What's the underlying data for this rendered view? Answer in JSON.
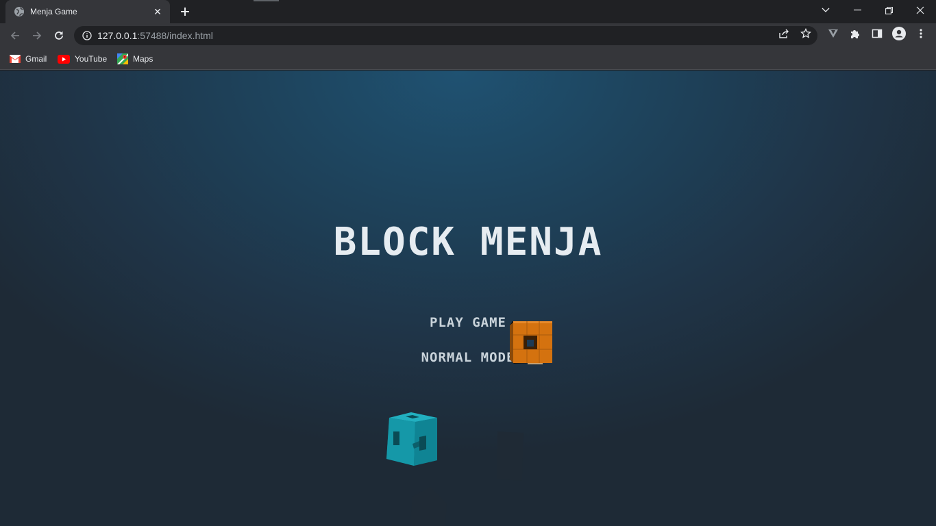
{
  "browser": {
    "tab": {
      "title": "Menja Game",
      "close_glyph": "✕",
      "favicon": "globe-icon"
    },
    "new_tab_glyph": "+",
    "window_controls": {
      "tab_search": "chevron-down-icon",
      "minimize": "minimize-icon",
      "restore": "restore-icon",
      "close": "close-icon"
    },
    "address": {
      "host": "127.0.0.1",
      "rest": ":57488/index.html"
    },
    "bookmarks": [
      {
        "label": "Gmail",
        "icon": "gmail-icon"
      },
      {
        "label": "YouTube",
        "icon": "youtube-icon"
      },
      {
        "label": "Maps",
        "icon": "maps-icon"
      }
    ]
  },
  "game": {
    "title": "BLOCK MENJA",
    "menu": {
      "play": "PLAY GAME",
      "mode": "NORMAL MODE"
    },
    "colors": {
      "orange_cube": "#d4720f",
      "teal_cube": "#1598a8",
      "dark_block": "#1f2a35",
      "title": "#e6ecf1"
    }
  }
}
